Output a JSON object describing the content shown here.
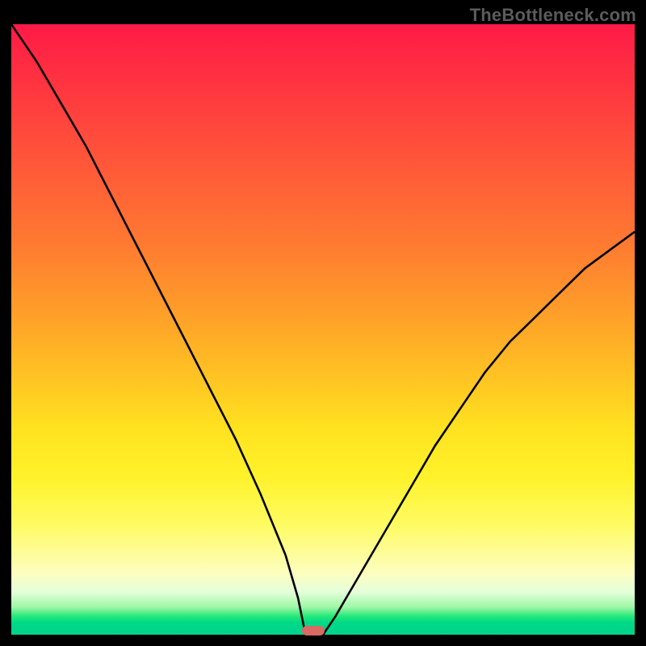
{
  "watermark": "TheBottleneck.com",
  "colors": {
    "background": "#000000",
    "curve": "#000000",
    "marker": "#d86a63",
    "gradient_top": "#ff1a46",
    "gradient_bottom": "#00d28c"
  },
  "chart_data": {
    "type": "line",
    "title": "",
    "xlabel": "",
    "ylabel": "",
    "xlim": [
      0,
      100
    ],
    "ylim": [
      0,
      100
    ],
    "x": [
      0,
      4,
      8,
      12,
      16,
      20,
      24,
      28,
      32,
      36,
      40,
      44,
      46,
      47,
      48,
      50,
      52,
      56,
      60,
      64,
      68,
      72,
      76,
      80,
      84,
      88,
      92,
      96,
      100
    ],
    "values": [
      100,
      94,
      87,
      80,
      72,
      64,
      56,
      48,
      40,
      32,
      23,
      13,
      6,
      1,
      0,
      0,
      3,
      10,
      17,
      24,
      31,
      37,
      43,
      48,
      52,
      56,
      60,
      63,
      66
    ],
    "marker": {
      "x": 48.5,
      "y": 0
    },
    "legend": null,
    "grid": false
  }
}
